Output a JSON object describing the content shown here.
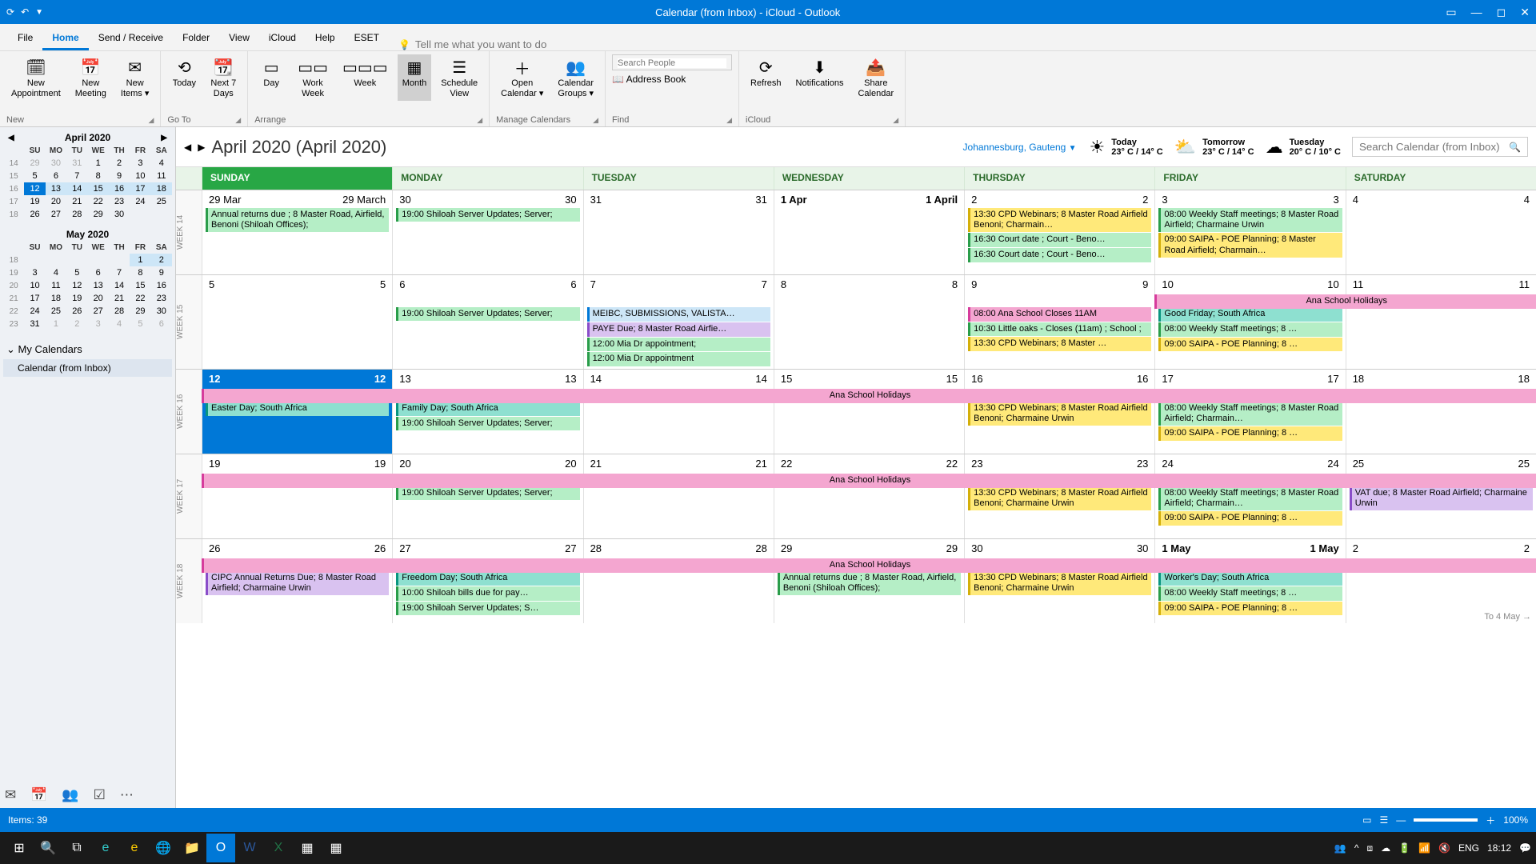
{
  "window": {
    "title": "Calendar (from Inbox) - iCloud  -  Outlook"
  },
  "menubar": {
    "tabs": [
      "File",
      "Home",
      "Send / Receive",
      "Folder",
      "View",
      "iCloud",
      "Help",
      "ESET"
    ],
    "active": 1,
    "tellme": "Tell me what you want to do"
  },
  "ribbon": {
    "groups": [
      {
        "label": "New",
        "btns": [
          {
            "ico": "🗓",
            "lbl": "New\nAppointment"
          },
          {
            "ico": "📅",
            "lbl": "New\nMeeting"
          },
          {
            "ico": "✉",
            "lbl": "New\nItems ▾"
          }
        ]
      },
      {
        "label": "Go To",
        "btns": [
          {
            "ico": "⟲",
            "lbl": "Today"
          },
          {
            "ico": "📆",
            "lbl": "Next 7\nDays"
          }
        ]
      },
      {
        "label": "Arrange",
        "btns": [
          {
            "ico": "▭",
            "lbl": "Day"
          },
          {
            "ico": "▭▭",
            "lbl": "Work\nWeek"
          },
          {
            "ico": "▭▭▭",
            "lbl": "Week"
          },
          {
            "ico": "▦",
            "lbl": "Month",
            "sel": true
          },
          {
            "ico": "☰",
            "lbl": "Schedule\nView"
          }
        ]
      },
      {
        "label": "Manage Calendars",
        "btns": [
          {
            "ico": "＋",
            "lbl": "Open\nCalendar ▾"
          },
          {
            "ico": "👥",
            "lbl": "Calendar\nGroups ▾"
          }
        ]
      },
      {
        "label": "Find",
        "special": "find"
      },
      {
        "label": "iCloud",
        "btns": [
          {
            "ico": "⟳",
            "lbl": "Refresh"
          },
          {
            "ico": "⬇",
            "lbl": "Notifications"
          },
          {
            "ico": "📤",
            "lbl": "Share\nCalendar"
          }
        ]
      }
    ],
    "searchPeople": "Search People",
    "addressBook": "Address Book"
  },
  "minical1": {
    "title": "April 2020",
    "dow": [
      "SU",
      "MO",
      "TU",
      "WE",
      "TH",
      "FR",
      "SA"
    ],
    "rows": [
      {
        "wk": "14",
        "d": [
          [
            "29",
            "ot"
          ],
          [
            "30",
            "ot"
          ],
          [
            "31",
            "ot"
          ],
          [
            "1",
            ""
          ],
          [
            "2",
            ""
          ],
          [
            "3",
            ""
          ],
          [
            "4",
            ""
          ]
        ]
      },
      {
        "wk": "15",
        "d": [
          [
            "5",
            ""
          ],
          [
            "6",
            ""
          ],
          [
            "7",
            ""
          ],
          [
            "8",
            ""
          ],
          [
            "9",
            ""
          ],
          [
            "10",
            ""
          ],
          [
            "11",
            ""
          ]
        ]
      },
      {
        "wk": "16",
        "d": [
          [
            "12",
            "today"
          ],
          [
            "13",
            "sel"
          ],
          [
            "14",
            "sel"
          ],
          [
            "15",
            "sel"
          ],
          [
            "16",
            "sel"
          ],
          [
            "17",
            "sel"
          ],
          [
            "18",
            "sel"
          ]
        ]
      },
      {
        "wk": "17",
        "d": [
          [
            "19",
            ""
          ],
          [
            "20",
            ""
          ],
          [
            "21",
            ""
          ],
          [
            "22",
            ""
          ],
          [
            "23",
            ""
          ],
          [
            "24",
            ""
          ],
          [
            "25",
            ""
          ]
        ]
      },
      {
        "wk": "18",
        "d": [
          [
            "26",
            ""
          ],
          [
            "27",
            ""
          ],
          [
            "28",
            ""
          ],
          [
            "29",
            ""
          ],
          [
            "30",
            ""
          ],
          [
            "",
            ""
          ],
          [
            "",
            ""
          ]
        ]
      }
    ]
  },
  "minical2": {
    "title": "May 2020",
    "dow": [
      "SU",
      "MO",
      "TU",
      "WE",
      "TH",
      "FR",
      "SA"
    ],
    "rows": [
      {
        "wk": "18",
        "d": [
          [
            "",
            ""
          ],
          [
            "",
            ""
          ],
          [
            "",
            ""
          ],
          [
            "",
            ""
          ],
          [
            "",
            ""
          ],
          [
            "1",
            "sel"
          ],
          [
            "2",
            "sel"
          ]
        ]
      },
      {
        "wk": "19",
        "d": [
          [
            "3",
            ""
          ],
          [
            "4",
            ""
          ],
          [
            "5",
            ""
          ],
          [
            "6",
            ""
          ],
          [
            "7",
            ""
          ],
          [
            "8",
            ""
          ],
          [
            "9",
            ""
          ]
        ]
      },
      {
        "wk": "20",
        "d": [
          [
            "10",
            ""
          ],
          [
            "11",
            ""
          ],
          [
            "12",
            ""
          ],
          [
            "13",
            ""
          ],
          [
            "14",
            ""
          ],
          [
            "15",
            ""
          ],
          [
            "16",
            ""
          ]
        ]
      },
      {
        "wk": "21",
        "d": [
          [
            "17",
            ""
          ],
          [
            "18",
            ""
          ],
          [
            "19",
            ""
          ],
          [
            "20",
            ""
          ],
          [
            "21",
            ""
          ],
          [
            "22",
            ""
          ],
          [
            "23",
            ""
          ]
        ]
      },
      {
        "wk": "22",
        "d": [
          [
            "24",
            ""
          ],
          [
            "25",
            ""
          ],
          [
            "26",
            ""
          ],
          [
            "27",
            ""
          ],
          [
            "28",
            ""
          ],
          [
            "29",
            ""
          ],
          [
            "30",
            ""
          ]
        ]
      },
      {
        "wk": "23",
        "d": [
          [
            "31",
            ""
          ],
          [
            "1",
            "ot"
          ],
          [
            "2",
            "ot"
          ],
          [
            "3",
            "ot"
          ],
          [
            "4",
            "ot"
          ],
          [
            "5",
            "ot"
          ],
          [
            "6",
            "ot"
          ]
        ]
      }
    ]
  },
  "caltree": {
    "hdr": "My Calendars",
    "item": "Calendar (from Inbox)"
  },
  "cvheader": {
    "title": "April 2020 (April 2020)",
    "location": "Johannesburg, Gauteng",
    "weather": [
      {
        "ico": "☀",
        "day": "Today",
        "tmp": "23° C / 14° C"
      },
      {
        "ico": "⛅",
        "day": "Tomorrow",
        "tmp": "23° C / 14° C"
      },
      {
        "ico": "☁",
        "day": "Tuesday",
        "tmp": "20° C / 10° C"
      }
    ],
    "search": "Search Calendar (from Inbox)"
  },
  "dayheaders": [
    "SUNDAY",
    "MONDAY",
    "TUESDAY",
    "WEDNESDAY",
    "THURSDAY",
    "FRIDAY",
    "SATURDAY"
  ],
  "weeks": [
    {
      "wk": "WEEK 14",
      "span": null,
      "days": [
        {
          "n": "29 Mar",
          "n2": "29 March",
          "evts": [
            {
              "t": "Annual returns due ; 8 Master Road, Airfield, Benoni (Shiloah Offices);",
              "c": "green",
              "w": true
            }
          ]
        },
        {
          "n": "30",
          "n2": "30",
          "evts": [
            {
              "t": "19:00 Shiloah Server Updates; Server;",
              "c": "green",
              "w": true
            }
          ]
        },
        {
          "n": "31",
          "n2": "31",
          "evts": []
        },
        {
          "n": "1 Apr",
          "n2": "1 April",
          "bold": true,
          "evts": []
        },
        {
          "n": "2",
          "n2": "2",
          "evts": [
            {
              "t": "13:30 CPD Webinars; 8 Master Road Airfield Benoni; Charmain…",
              "c": "yellow",
              "w": true
            },
            {
              "t": "16:30 Court date ; Court - Beno…",
              "c": "green"
            },
            {
              "t": "16:30 Court date ; Court - Beno…",
              "c": "green"
            }
          ]
        },
        {
          "n": "3",
          "n2": "3",
          "evts": [
            {
              "t": "08:00 Weekly Staff meetings; 8 Master Road Airfield; Charmaine Urwin",
              "c": "green",
              "w": true
            },
            {
              "t": "09:00 SAIPA - POE Planning; 8 Master Road Airfield; Charmain…",
              "c": "yellow",
              "w": true
            }
          ]
        },
        {
          "n": "4",
          "n2": "4",
          "evts": []
        }
      ]
    },
    {
      "wk": "WEEK 15",
      "span": {
        "t": "Ana School Holidays",
        "from": 5,
        "to": 7
      },
      "days": [
        {
          "n": "5",
          "n2": "5",
          "evts": []
        },
        {
          "n": "6",
          "n2": "6",
          "evts": [
            {
              "t": "19:00 Shiloah Server Updates; Server;",
              "c": "green",
              "w": true
            }
          ]
        },
        {
          "n": "7",
          "n2": "7",
          "evts": [
            {
              "t": "MEIBC, SUBMISSIONS, VALISTA…",
              "c": "blue"
            },
            {
              "t": "PAYE Due; 8 Master Road Airfie…",
              "c": "purple"
            },
            {
              "t": "12:00 Mia Dr appointment;",
              "c": "green"
            },
            {
              "t": "12:00 Mia Dr appointment",
              "c": "green"
            }
          ]
        },
        {
          "n": "8",
          "n2": "8",
          "evts": []
        },
        {
          "n": "9",
          "n2": "9",
          "evts": [
            {
              "t": "08:00 Ana School Closes 11AM",
              "c": "pink"
            },
            {
              "t": "10:30 Little oaks - Closes (11am) ; School ;",
              "c": "green",
              "w": true
            },
            {
              "t": "13:30 CPD Webinars; 8 Master …",
              "c": "yellow"
            }
          ]
        },
        {
          "n": "10",
          "n2": "10",
          "evts": [
            {
              "t": "Good Friday; South Africa",
              "c": "teal"
            },
            {
              "t": "08:00 Weekly Staff meetings; 8 …",
              "c": "green"
            },
            {
              "t": "09:00 SAIPA - POE Planning; 8 …",
              "c": "yellow"
            }
          ]
        },
        {
          "n": "11",
          "n2": "11",
          "evts": []
        }
      ]
    },
    {
      "wk": "WEEK 16",
      "span": {
        "t": "Ana School Holidays",
        "from": 0,
        "to": 7
      },
      "days": [
        {
          "n": "12",
          "n2": "12",
          "today": true,
          "evts": [
            {
              "t": "Easter Day; South Africa",
              "c": "teal"
            }
          ]
        },
        {
          "n": "13",
          "n2": "13",
          "evts": [
            {
              "t": "Family Day; South Africa",
              "c": "teal"
            },
            {
              "t": "19:00 Shiloah Server Updates; Server;",
              "c": "green",
              "w": true
            }
          ]
        },
        {
          "n": "14",
          "n2": "14",
          "evts": []
        },
        {
          "n": "15",
          "n2": "15",
          "evts": []
        },
        {
          "n": "16",
          "n2": "16",
          "evts": [
            {
              "t": "13:30 CPD Webinars; 8 Master Road Airfield Benoni; Charmaine Urwin",
              "c": "yellow",
              "w": true
            }
          ]
        },
        {
          "n": "17",
          "n2": "17",
          "evts": [
            {
              "t": "08:00 Weekly Staff meetings; 8 Master Road Airfield; Charmain…",
              "c": "green",
              "w": true
            },
            {
              "t": "09:00 SAIPA - POE Planning; 8 …",
              "c": "yellow"
            }
          ]
        },
        {
          "n": "18",
          "n2": "18",
          "evts": []
        }
      ]
    },
    {
      "wk": "WEEK 17",
      "span": {
        "t": "Ana School Holidays",
        "from": 0,
        "to": 7
      },
      "days": [
        {
          "n": "19",
          "n2": "19",
          "evts": []
        },
        {
          "n": "20",
          "n2": "20",
          "evts": [
            {
              "t": "19:00 Shiloah Server Updates; Server;",
              "c": "green",
              "w": true
            }
          ]
        },
        {
          "n": "21",
          "n2": "21",
          "evts": []
        },
        {
          "n": "22",
          "n2": "22",
          "evts": []
        },
        {
          "n": "23",
          "n2": "23",
          "evts": [
            {
              "t": "13:30 CPD Webinars; 8 Master Road Airfield Benoni; Charmaine Urwin",
              "c": "yellow",
              "w": true
            }
          ]
        },
        {
          "n": "24",
          "n2": "24",
          "evts": [
            {
              "t": "08:00 Weekly Staff meetings; 8 Master Road Airfield; Charmain…",
              "c": "green",
              "w": true
            },
            {
              "t": "09:00 SAIPA - POE Planning; 8 …",
              "c": "yellow"
            }
          ]
        },
        {
          "n": "25",
          "n2": "25",
          "evts": [
            {
              "t": "VAT due; 8 Master Road Airfield; Charmaine Urwin",
              "c": "purple",
              "w": true
            }
          ]
        }
      ]
    },
    {
      "wk": "WEEK 18",
      "span": {
        "t": "Ana School Holidays",
        "from": 0,
        "to": 7
      },
      "next": "To 4 May →",
      "days": [
        {
          "n": "26",
          "n2": "26",
          "evts": [
            {
              "t": "CIPC Annual Returns Due; 8 Master Road Airfield; Charmaine Urwin",
              "c": "purple",
              "w": true
            }
          ]
        },
        {
          "n": "27",
          "n2": "27",
          "evts": [
            {
              "t": "Freedom Day; South Africa",
              "c": "teal"
            },
            {
              "t": "10:00 Shiloah bills due for pay…",
              "c": "green"
            },
            {
              "t": "19:00 Shiloah Server Updates; S…",
              "c": "green"
            }
          ]
        },
        {
          "n": "28",
          "n2": "28",
          "evts": []
        },
        {
          "n": "29",
          "n2": "29",
          "evts": [
            {
              "t": "Annual returns due ; 8 Master Road, Airfield, Benoni (Shiloah Offices);",
              "c": "green",
              "w": true
            }
          ]
        },
        {
          "n": "30",
          "n2": "30",
          "evts": [
            {
              "t": "13:30 CPD Webinars; 8 Master Road Airfield Benoni; Charmaine Urwin",
              "c": "yellow",
              "w": true
            }
          ]
        },
        {
          "n": "1 May",
          "n2": "1 May",
          "bold": true,
          "evts": [
            {
              "t": "Worker's Day; South Africa",
              "c": "teal"
            },
            {
              "t": "08:00 Weekly Staff meetings; 8 …",
              "c": "green"
            },
            {
              "t": "09:00 SAIPA - POE Planning; 8 …",
              "c": "yellow"
            }
          ]
        },
        {
          "n": "2",
          "n2": "2",
          "evts": []
        }
      ]
    }
  ],
  "status": {
    "items": "Items: 39",
    "zoom": "100%"
  },
  "taskbar": {
    "clock": "18:12",
    "lang": "ENG"
  }
}
